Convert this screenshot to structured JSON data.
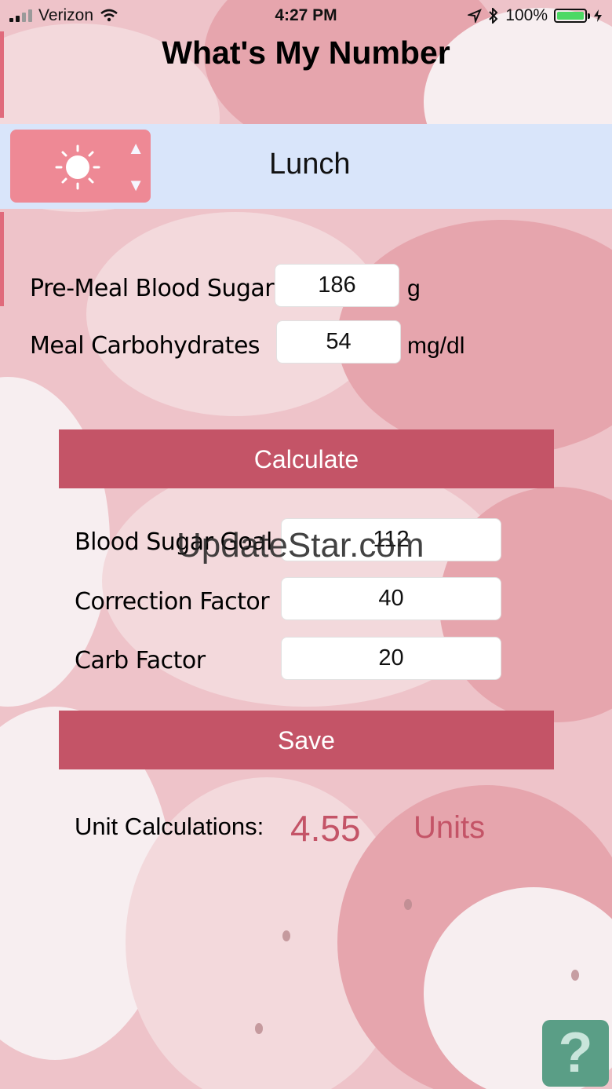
{
  "status_bar": {
    "carrier": "Verizon",
    "time": "4:27 PM",
    "battery": "100%",
    "icons": [
      "signal-icon",
      "wifi-icon",
      "location-icon",
      "bluetooth-icon",
      "battery-icon",
      "charging-icon"
    ]
  },
  "app": {
    "title": "What's My Number"
  },
  "meal": {
    "icon": "sun-icon",
    "selected": "Lunch"
  },
  "inputs": {
    "pre_meal_blood_sugar": {
      "label": "Pre-Meal Blood Sugar",
      "value": "186",
      "unit": "g"
    },
    "meal_carbohydrates": {
      "label": "Meal Carbohydrates",
      "value": "54",
      "unit": "mg/dl"
    }
  },
  "buttons": {
    "calculate": "Calculate",
    "save": "Save",
    "help": "?"
  },
  "settings": {
    "blood_sugar_goal": {
      "label": "Blood Sugar Goal",
      "value": "112"
    },
    "correction_factor": {
      "label": "Correction Factor",
      "value": "40"
    },
    "carb_factor": {
      "label": "Carb Factor",
      "value": "20"
    }
  },
  "result": {
    "label": "Unit Calculations:",
    "value": "4.55",
    "unit": "Units"
  },
  "watermark": "UpdateStar.com",
  "colors": {
    "accent": "#c45467",
    "band": "#d9e5fa",
    "picker": "#ee8995",
    "help": "#5a9e86"
  }
}
